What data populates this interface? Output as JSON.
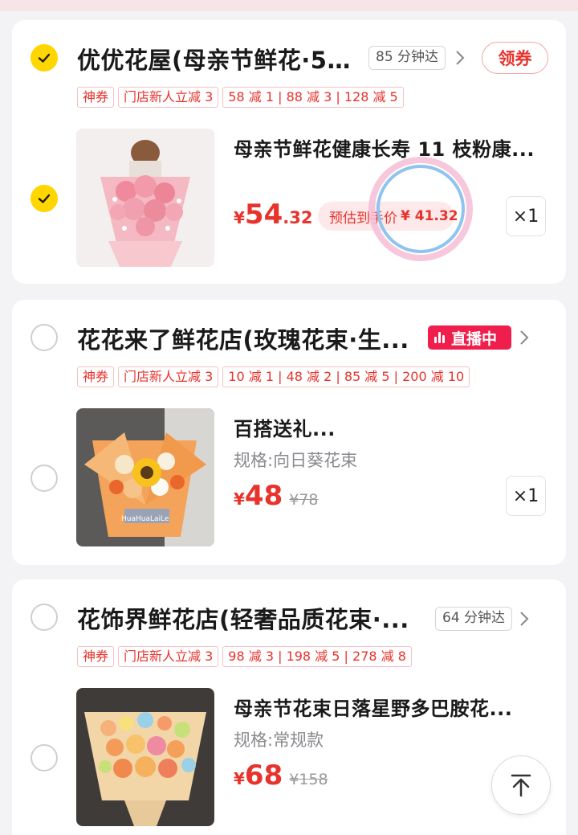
{
  "stores": [
    {
      "name": "优优花屋(母亲节鲜花·52...",
      "checked": true,
      "eta": "85 分钟达",
      "coupon_button": "领券",
      "tags": [
        "神券",
        "门店新人立减 3",
        "58 减 1 | 88 减 3 | 128 减 5"
      ],
      "item": {
        "checked": true,
        "title": "母亲节鲜花健康长寿 11 枝粉康...",
        "price_symbol": "¥",
        "price_int": "54",
        "price_dec": ".32",
        "estimate_label": "预估到手价",
        "estimate_value": "¥ 41.32",
        "qty": "×1"
      }
    },
    {
      "name": "花花来了鲜花店(玫瑰花束·生...",
      "checked": false,
      "live_badge": "直播中",
      "tags": [
        "神券",
        "门店新人立减 3",
        "10 减 1 | 48 减 2 | 85 减 5 | 200 减 10"
      ],
      "item": {
        "checked": false,
        "title": "百搭送礼...",
        "spec": "规格:向日葵花束",
        "price_symbol": "¥",
        "price_int": "48",
        "original_price": "¥78",
        "qty": "×1"
      }
    },
    {
      "name": "花饰界鲜花店(轻奢品质花束·...",
      "checked": false,
      "eta": "64 分钟达",
      "tags": [
        "神券",
        "门店新人立减 3",
        "98 减 3 | 198 减 5 | 278 减 8"
      ],
      "item": {
        "checked": false,
        "title": "母亲节花束日落星野多巴胺花...",
        "spec": "规格:常规款",
        "price_symbol": "¥",
        "price_int": "68",
        "original_price": "¥158"
      }
    }
  ],
  "colors": {
    "accent": "#e8322c",
    "check": "#ffd600",
    "live": "#f01e4c"
  },
  "icons": [
    "check-icon",
    "chevron-right-icon",
    "live-bars-icon",
    "back-to-top-icon"
  ]
}
